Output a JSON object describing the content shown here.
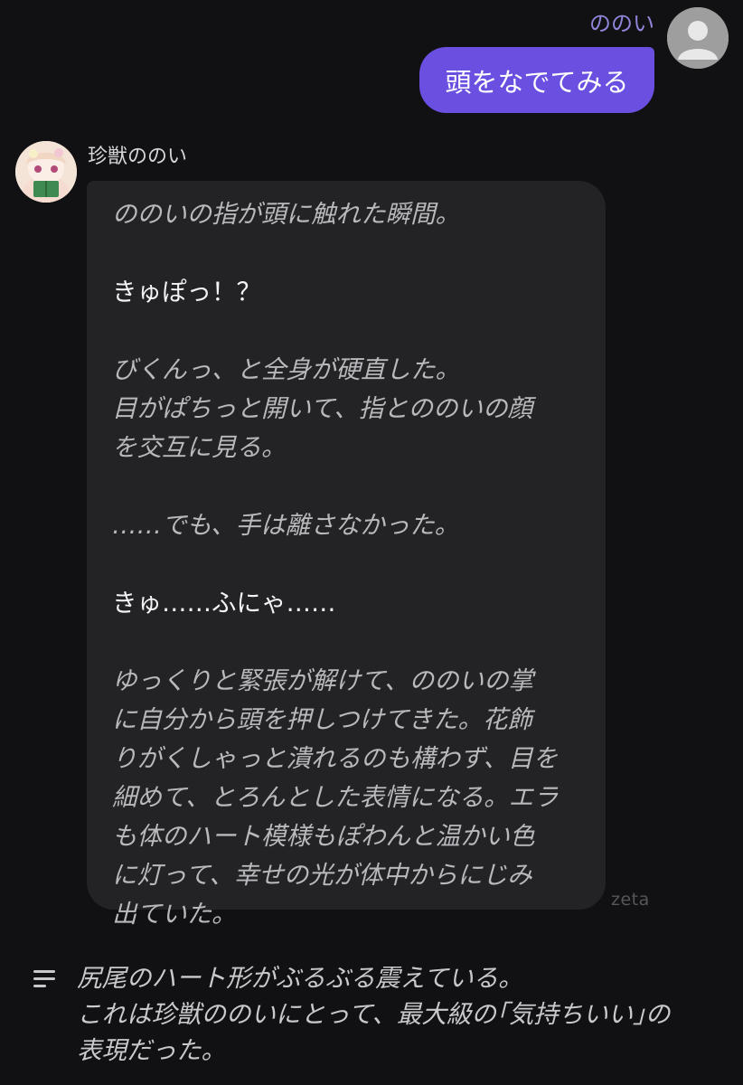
{
  "user_message": {
    "name": "ののい",
    "text": "頭をなでてみる",
    "avatar_icon": "default-user-icon",
    "bubble_color": "#6a4fe0"
  },
  "character_message": {
    "name": "珍獣ののい",
    "avatar_icon": "character-portrait",
    "bubble_color": "#232326",
    "paragraphs": [
      {
        "type": "narration",
        "text": "ののいの指が頭に触れた瞬間。"
      },
      {
        "type": "dialogue",
        "text": "きゅぽっ！？"
      },
      {
        "type": "narration",
        "text": "びくんっ、と全身が硬直した。\n目がぱちっと開いて、指とののいの顔\nを交互に見る。"
      },
      {
        "type": "narration",
        "text": "……でも、手は離さなかった。"
      },
      {
        "type": "dialogue",
        "text": "きゅ……ふにゃ……"
      },
      {
        "type": "narration",
        "text": "ゆっくりと緊張が解けて、ののいの掌\nに自分から頭を押しつけてきた。花飾\nりがくしゃっと潰れるのも構わず、目を\n細めて、とろんとした表情になる。エラ\nも体のハート模様もぽわんと温かい色\nに灯って、幸せの光が体中からにじみ\n出ていた。"
      }
    ],
    "watermark": "zeta"
  },
  "summary": {
    "icon": "menu-lines-icon",
    "text": "尻尾のハート形がぶるぶる震えている。\nこれは珍獣ののいにとって、最大級の｢気持ちいい｣の\n表現だった。"
  }
}
